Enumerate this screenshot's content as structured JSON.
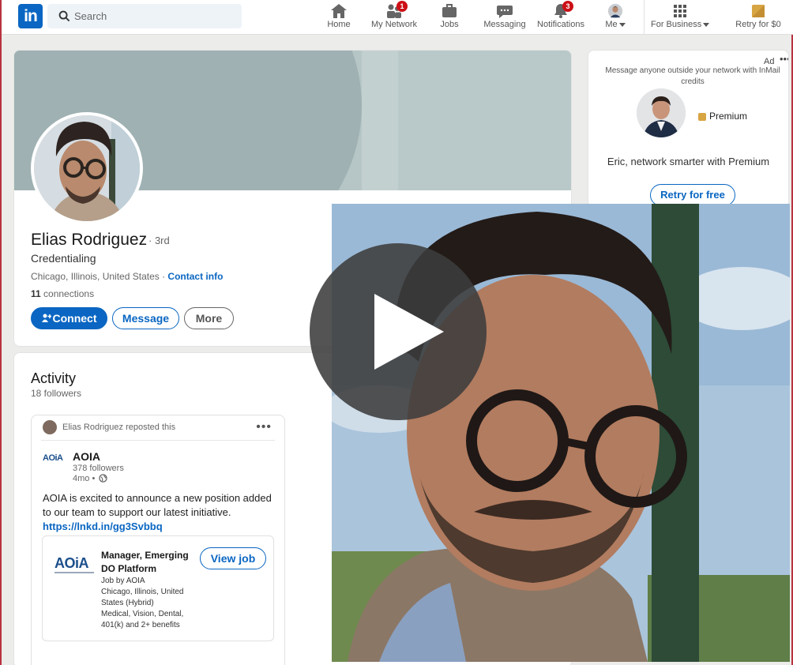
{
  "nav": {
    "logo_text": "in",
    "search_placeholder": "Search",
    "items": [
      {
        "label": "Home",
        "icon": "home-icon"
      },
      {
        "label": "My Network",
        "icon": "network-icon",
        "badge": "1"
      },
      {
        "label": "Jobs",
        "icon": "briefcase-icon"
      },
      {
        "label": "Messaging",
        "icon": "messaging-icon"
      },
      {
        "label": "Notifications",
        "icon": "bell-icon",
        "badge": "3"
      },
      {
        "label": "Me",
        "icon": "avatar"
      },
      {
        "label": "For Business",
        "icon": "grid-icon"
      },
      {
        "label": "Retry for $0",
        "icon": "premium-icon"
      }
    ]
  },
  "profile": {
    "name": "Elias Rodriguez",
    "degree": "· 3rd",
    "headline": "Credentialing",
    "location": "Chicago, Illinois, United States · ",
    "contact_link": "Contact info",
    "connections_count": "11",
    "connections_label": " connections",
    "buttons": {
      "connect": "Connect",
      "message": "Message",
      "more": "More"
    }
  },
  "activity": {
    "title": "Activity",
    "followers": "18 followers",
    "post": {
      "repost_text": "Elias Rodriguez reposted this",
      "org_logo": "AOiA",
      "org_name": "AOIA",
      "org_followers": "378 followers",
      "org_time": "4mo •",
      "text": "AOIA is excited to announce a new position added to our team to support our latest initiative. ",
      "link": "https://lnkd.in/gg3Svbbq",
      "job": {
        "logo": "AOiA",
        "title": "Manager, Emerging DO Platform",
        "details": "Job by AOIA\nChicago, Illinois, United States (Hybrid)\nMedical, Vision, Dental, 401(k) and 2+ benefits",
        "button": "View job"
      }
    }
  },
  "ad": {
    "label": "Ad",
    "menu": "•••",
    "text": "Message anyone outside your network with InMail credits",
    "premium": "Premium",
    "line": "Eric, network smarter with Premium",
    "button": "Retry for free"
  },
  "colors": {
    "brand": "#0a66c2",
    "badge": "#cc1016",
    "border_accent": "#b8323f"
  }
}
